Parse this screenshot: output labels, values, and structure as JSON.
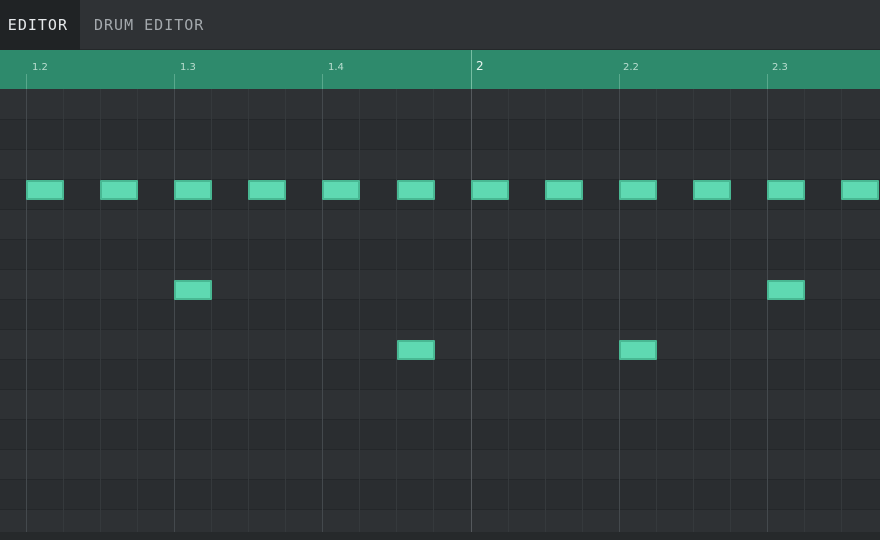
{
  "tabs": {
    "piano_roll": "E EDITOR",
    "drum_editor": "DRUM EDITOR"
  },
  "timeline": {
    "markers": [
      "1.2",
      "1.3",
      "1.4",
      "2",
      "2.2",
      "2.3"
    ]
  },
  "colors": {
    "timeline": "#2e8a6c",
    "note_fill": "#5fd9b2",
    "note_border": "#49b893",
    "grid_bg": "#2c2f32"
  }
}
